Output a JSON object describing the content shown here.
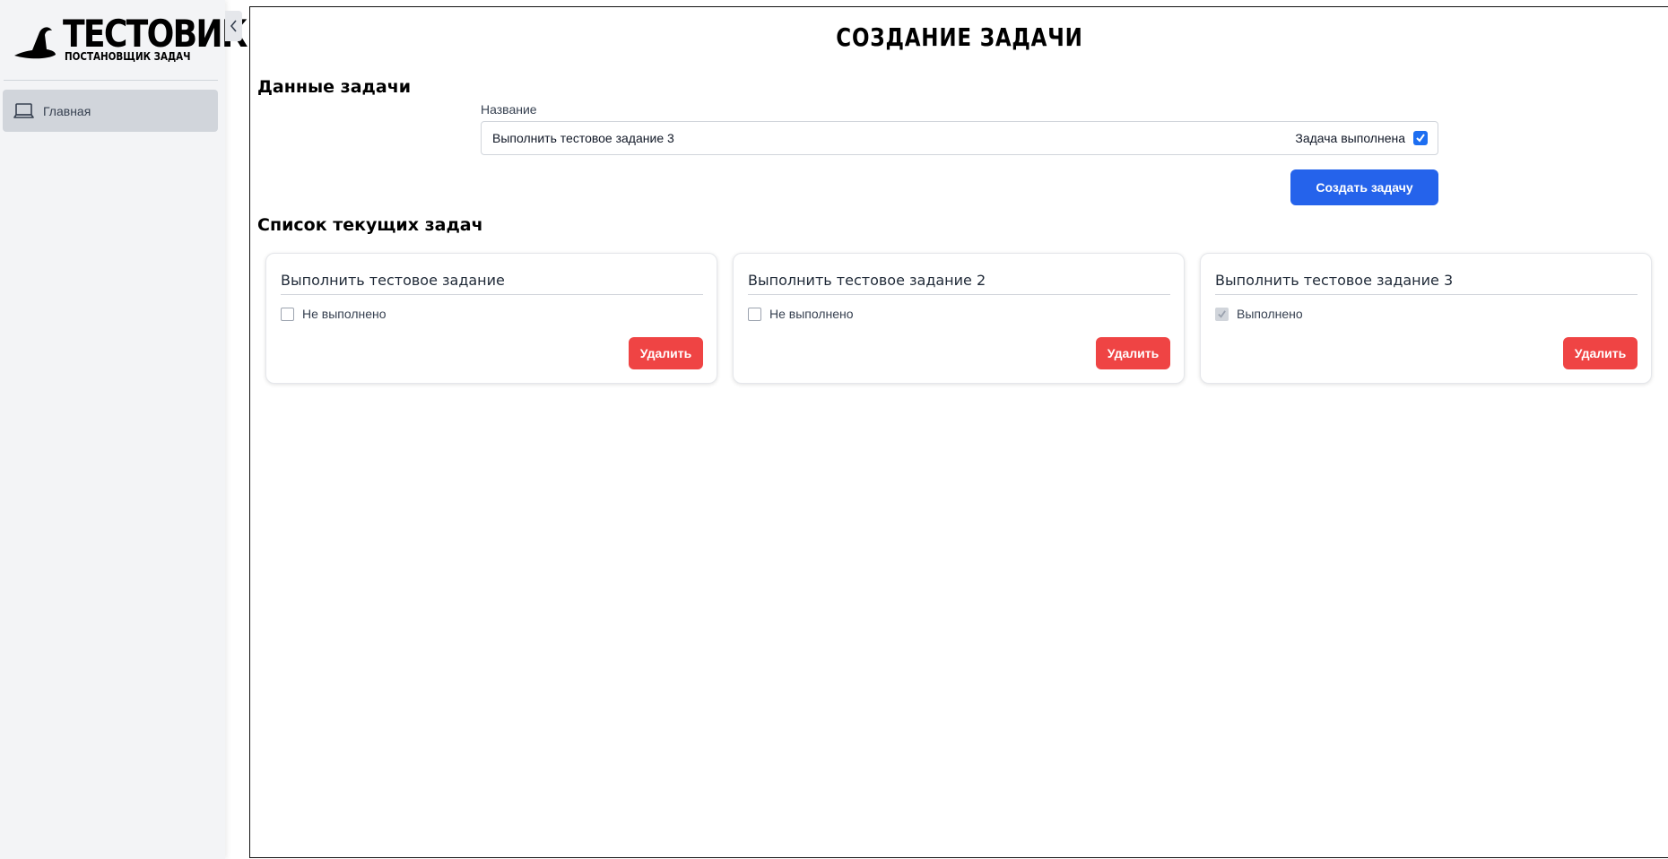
{
  "logo": {
    "title": "ТЕСТОВИК",
    "subtitle": "ПОСТАНОВЩИК ЗАДАЧ",
    "icon": "wizard-hat-icon"
  },
  "sidebar": {
    "items": [
      {
        "label": "Главная",
        "icon": "laptop-icon"
      }
    ],
    "collapse_icon": "chevron-left-icon"
  },
  "page": {
    "title": "СОЗДАНИЕ ЗАДАЧИ"
  },
  "form": {
    "section_title": "Данные задачи",
    "name_label": "Название",
    "name_value": "Выполнить тестовое задание 3",
    "done_label": "Задача выполнена",
    "done_checked": true,
    "create_button": "Создать задачу"
  },
  "tasks_section": {
    "title": "Список текущих задач",
    "tasks": [
      {
        "title": "Выполнить тестовое задание",
        "status": "Не выполнено",
        "done": false,
        "delete_label": "Удалить"
      },
      {
        "title": "Выполнить тестовое задание 2",
        "status": "Не выполнено",
        "done": false,
        "delete_label": "Удалить"
      },
      {
        "title": "Выполнить тестовое задание 3",
        "status": "Выполнено",
        "done": true,
        "delete_label": "Удалить"
      }
    ]
  },
  "colors": {
    "primary": "#2563eb",
    "danger": "#ef4444",
    "sidebar_bg": "#f3f4f6",
    "active_item": "#d1d5db"
  }
}
